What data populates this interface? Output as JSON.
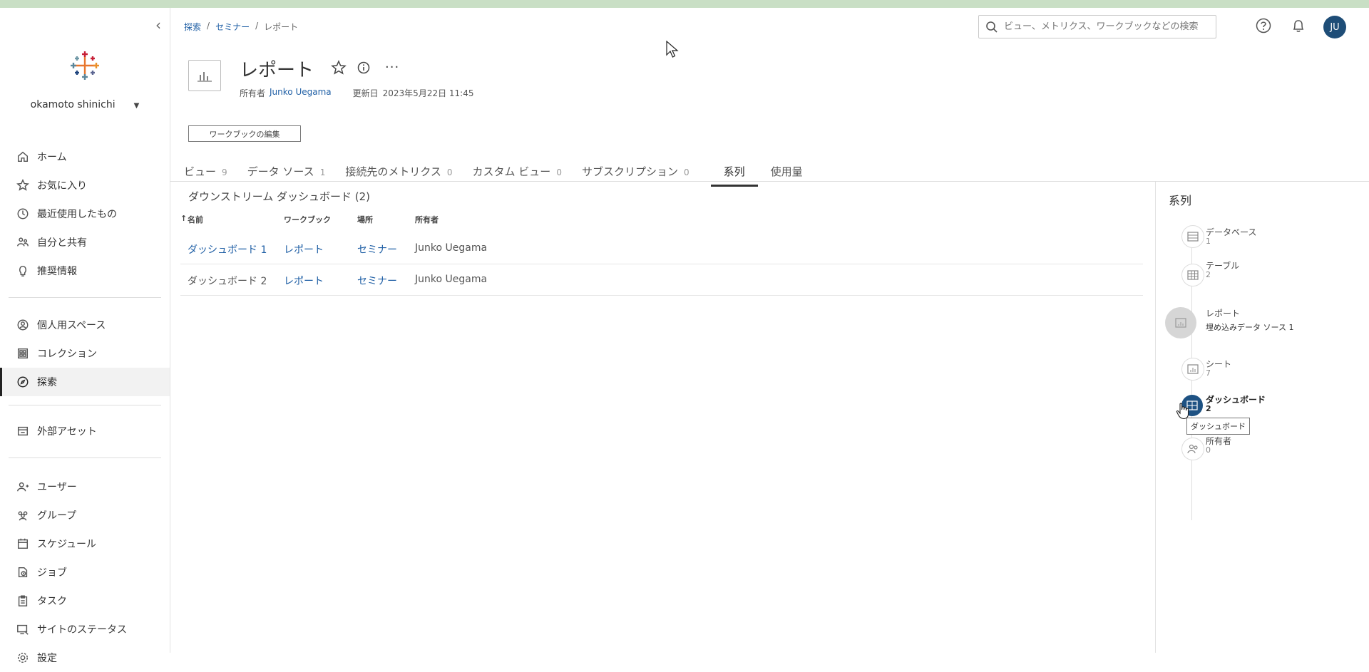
{
  "sidebar": {
    "user_name": "okamoto shinichi",
    "nav_primary": [
      {
        "label": "ホーム",
        "icon": "home-icon"
      },
      {
        "label": "お気に入り",
        "icon": "star-icon"
      },
      {
        "label": "最近使用したもの",
        "icon": "clock-icon"
      },
      {
        "label": "自分と共有",
        "icon": "shared-users-icon"
      },
      {
        "label": "推奨情報",
        "icon": "lightbulb-icon"
      }
    ],
    "nav_secondary": [
      {
        "label": "個人用スペース",
        "icon": "personal-space-icon"
      },
      {
        "label": "コレクション",
        "icon": "collection-icon"
      },
      {
        "label": "探索",
        "icon": "compass-icon",
        "active": true
      }
    ],
    "nav_tertiary": [
      {
        "label": "外部アセット",
        "icon": "external-assets-icon"
      }
    ],
    "nav_admin": [
      {
        "label": "ユーザー",
        "icon": "user-icon"
      },
      {
        "label": "グループ",
        "icon": "group-icon"
      },
      {
        "label": "スケジュール",
        "icon": "calendar-icon"
      },
      {
        "label": "ジョブ",
        "icon": "job-icon"
      },
      {
        "label": "タスク",
        "icon": "task-icon"
      },
      {
        "label": "サイトのステータス",
        "icon": "site-status-icon"
      },
      {
        "label": "設定",
        "icon": "gear-icon"
      }
    ]
  },
  "breadcrumb": {
    "items": [
      "探索",
      "セミナー",
      "レポート"
    ],
    "separator": "/"
  },
  "header": {
    "search_placeholder": "ビュー、メトリクス、ワークブックなどの検索",
    "avatar_initials": "JU"
  },
  "workbook": {
    "title": "レポート",
    "owner_label": "所有者",
    "owner": "Junko Uegama",
    "updated_label": "更新日",
    "updated": "2023年5月22日 11:45",
    "edit_button": "ワークブックの編集",
    "more": "···"
  },
  "tabs": [
    {
      "label": "ビュー",
      "count": "9"
    },
    {
      "label": "データ ソース",
      "count": "1"
    },
    {
      "label": "接続先のメトリクス",
      "count": "0"
    },
    {
      "label": "カスタム ビュー",
      "count": "0"
    },
    {
      "label": "サブスクリプション",
      "count": "0"
    },
    {
      "label": "系列",
      "count": "",
      "active": true
    },
    {
      "label": "使用量",
      "count": ""
    }
  ],
  "downstream": {
    "title": "ダウンストリーム ダッシュボード (2)",
    "columns": [
      "名前",
      "ワークブック",
      "場所",
      "所有者"
    ],
    "sort_indicator": "↑",
    "rows": [
      {
        "name": "ダッシュボード 1",
        "workbook": "レポート",
        "location": "セミナー",
        "owner": "Junko Uegama"
      },
      {
        "name": "ダッシュボード 2",
        "workbook": "レポート",
        "location": "セミナー",
        "owner": "Junko Uegama"
      }
    ]
  },
  "lineage": {
    "title": "系列",
    "nodes": [
      {
        "label": "データベース",
        "value": "1",
        "icon": "database-icon"
      },
      {
        "label": "テーブル",
        "value": "2",
        "icon": "table-icon"
      },
      {
        "label": "レポート",
        "value": "埋め込みデータ ソース 1",
        "icon": "workbook-icon"
      },
      {
        "label": "シート",
        "value": "7",
        "icon": "sheet-icon"
      },
      {
        "label": "ダッシュボード",
        "value": "2",
        "icon": "dashboard-icon"
      },
      {
        "label": "所有者",
        "value": "0",
        "icon": "owner-icon"
      }
    ],
    "tooltip": "ダッシュボード"
  },
  "colors": {
    "link": "#1f5fa5",
    "avatar": "#1e4d77",
    "dashboard_node": "#1e5283",
    "top_strip": "#c9dfc5"
  }
}
